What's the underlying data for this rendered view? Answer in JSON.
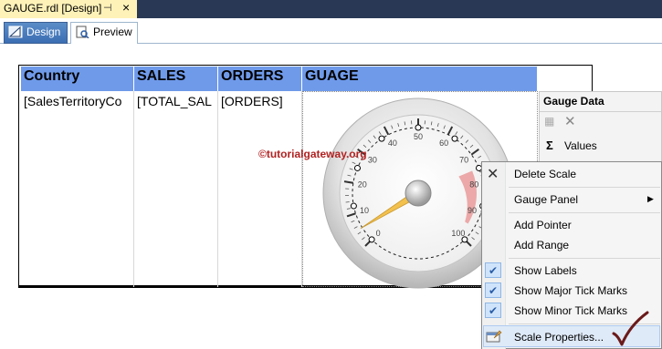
{
  "document_tab": {
    "title": "GAUGE.rdl [Design]",
    "pin": "⊣",
    "close": "×"
  },
  "view_tabs": [
    {
      "label": "Design"
    },
    {
      "label": "Preview"
    }
  ],
  "table": {
    "headers": [
      "Country",
      "SALES",
      "ORDERS",
      "GUAGE"
    ],
    "row": [
      "[SalesTerritoryCo",
      "[TOTAL_SAL",
      "[ORDERS]",
      ""
    ]
  },
  "gauge": {
    "scale_labels": [
      "0",
      "10",
      "20",
      "30",
      "40",
      "50",
      "60",
      "70",
      "80",
      "90",
      "100"
    ],
    "min": 0,
    "max": 100,
    "pointer_value": 5,
    "range_start": 75,
    "range_end": 95
  },
  "watermark": "©tutorialgateway.org",
  "gauge_data_panel": {
    "title": "Gauge Data",
    "sigma": "Σ",
    "values_label": "Values"
  },
  "context_menu": {
    "items": [
      {
        "label": "Delete Scale"
      },
      {
        "label": "Gauge Panel",
        "submenu": true
      },
      {
        "label": "Add Pointer"
      },
      {
        "label": "Add Range"
      },
      {
        "label": "Show Labels",
        "checked": true
      },
      {
        "label": "Show Major Tick Marks",
        "checked": true
      },
      {
        "label": "Show Minor Tick Marks",
        "checked": true
      },
      {
        "label": "Scale Properties...",
        "highlighted": true
      }
    ]
  },
  "colors": {
    "header_bg": "#6f9aea",
    "tab_active": "#3b6eb3",
    "doc_tab": "#fff2b8",
    "range": "#e88080"
  }
}
